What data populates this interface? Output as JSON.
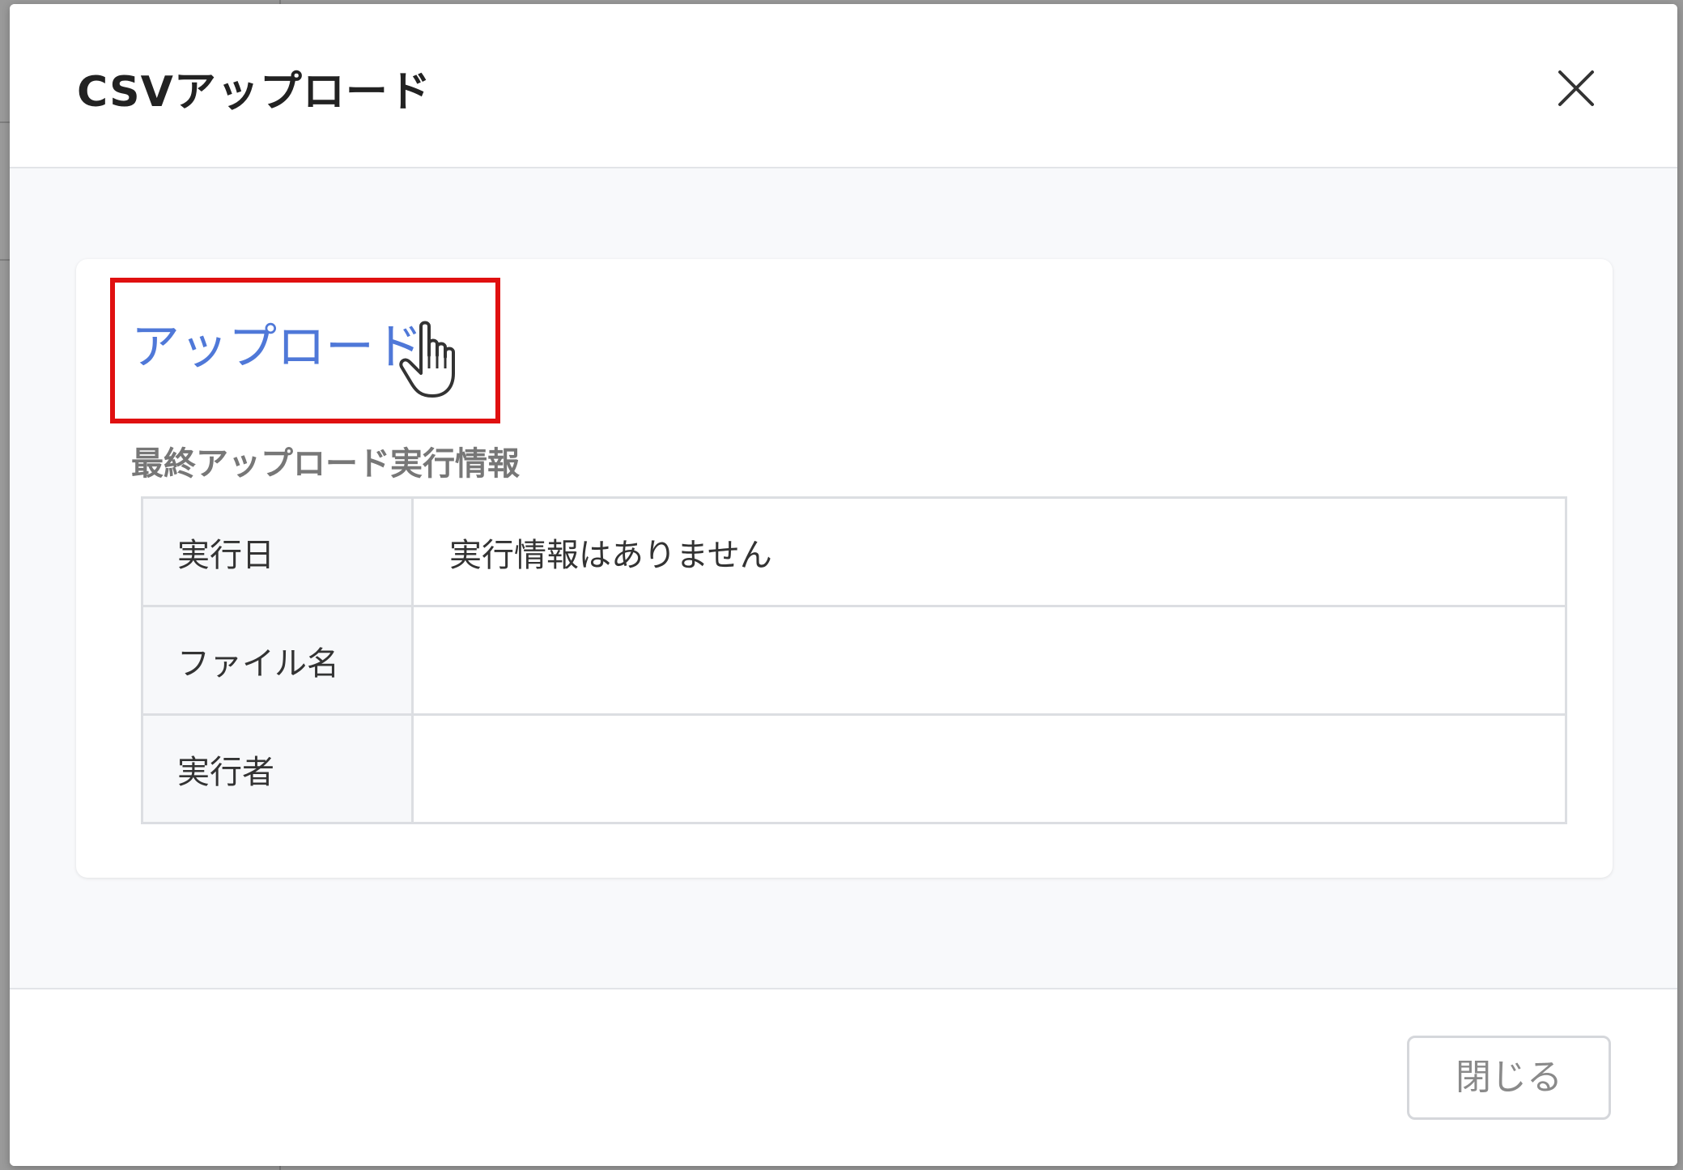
{
  "dialog": {
    "title": "CSVアップロード",
    "close_icon": "close-icon"
  },
  "upload": {
    "link_label": "アップロード",
    "cursor_icon": "hand-pointer-icon",
    "highlight_color": "#e01010",
    "link_color": "#4f78d8"
  },
  "last_upload": {
    "section_title": "最終アップロード実行情報",
    "rows": [
      {
        "label": "実行日",
        "value": "実行情報はありません"
      },
      {
        "label": "ファイル名",
        "value": ""
      },
      {
        "label": "実行者",
        "value": ""
      }
    ]
  },
  "footer": {
    "close_label": "閉じる"
  }
}
